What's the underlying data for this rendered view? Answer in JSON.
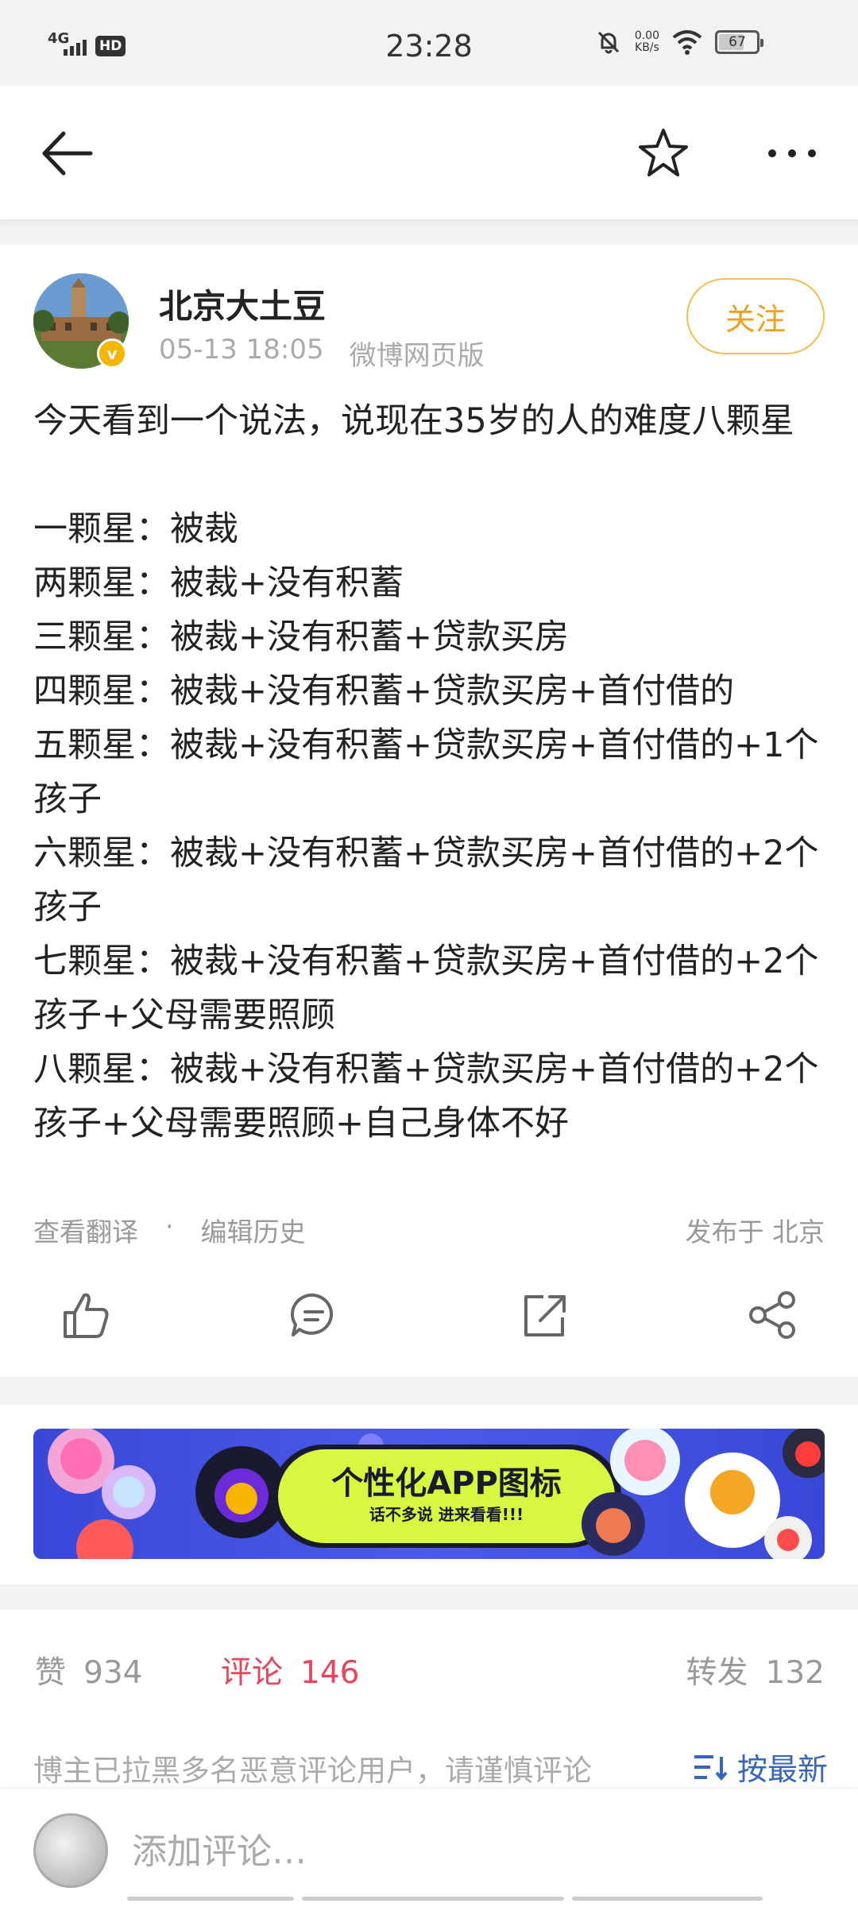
{
  "status_bar": {
    "network": "4G",
    "hd": "HD",
    "time": "23:28",
    "speed_value": "0.00",
    "speed_unit": "KB/s",
    "battery": "67"
  },
  "nav": {
    "back_icon": "back-arrow-icon",
    "favorite_icon": "star-icon",
    "more_icon": "more-dots-icon"
  },
  "post": {
    "author": "北京大土豆",
    "verified_icon": "verified-badge-icon",
    "date": "05-13 18:05",
    "source": "微博网页版",
    "follow_label": "关注",
    "content": "今天看到一个说法，说现在35岁的人的难度八颗星\n\n一颗星：被裁\n两颗星：被裁+没有积蓄\n三颗星：被裁+没有积蓄+贷款买房\n四颗星：被裁+没有积蓄+贷款买房+首付借的\n五颗星：被裁+没有积蓄+贷款买房+首付借的+1个孩子\n六颗星：被裁+没有积蓄+贷款买房+首付借的+2个孩子\n七颗星：被裁+没有积蓄+贷款买房+首付借的+2个孩子+父母需要照顾\n八颗星：被裁+没有积蓄+贷款买房+首付借的+2个孩子+父母需要照顾+自己身体不好",
    "translate": "查看翻译",
    "separator": "·",
    "edit_history": "编辑历史",
    "location": "发布于 北京"
  },
  "actions": [
    "like-icon",
    "comment-icon",
    "repost-icon",
    "share-icon"
  ],
  "banner": {
    "title": "个性化APP图标",
    "subtitle": "话不多说 进来看看!!!"
  },
  "stats": {
    "likes_label": "赞",
    "likes_count": "934",
    "comments_label": "评论",
    "comments_count": "146",
    "reposts_label": "转发",
    "reposts_count": "132"
  },
  "comments": {
    "notice": "博主已拉黑多名恶意评论用户，请谨慎评论",
    "sort_label": "按最新",
    "input_placeholder": "添加评论…"
  },
  "colors": {
    "accent": "#f0a020",
    "active_tab": "#e8455c",
    "link": "#3766b9"
  }
}
